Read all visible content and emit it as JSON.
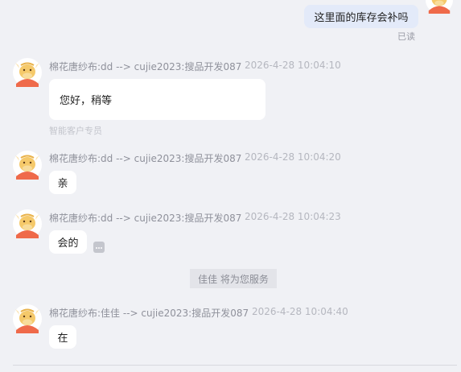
{
  "own_message": {
    "text": "这里面的库存会补吗",
    "status": "已读"
  },
  "messages": [
    {
      "sender": "棉花唐纱布:dd --> cujie2023:搜品开发087",
      "time": "2026-4-28 10:04:10",
      "text": "您好，稍等",
      "tag": "智能客户专员"
    },
    {
      "sender": "棉花唐纱布:dd --> cujie2023:搜品开发087",
      "time": "2026-4-28 10:04:20",
      "text": "亲"
    },
    {
      "sender": "棉花唐纱布:dd --> cujie2023:搜品开发087",
      "time": "2026-4-28 10:04:23",
      "text": "会的"
    },
    {
      "sender": "棉花唐纱布:佳佳 --> cujie2023:搜品开发087",
      "time": "2026-4-28 10:04:40",
      "text": "在"
    }
  ],
  "system_notice": "佳佳 将为您服务",
  "colors": {
    "background": "#f0f1f5",
    "own_bubble": "#e3eaf9",
    "bubble": "#ffffff",
    "avatar_face": "#f5c96a",
    "avatar_body": "#ef6a4a"
  },
  "icons": {
    "avatar": "bull-mascot-avatar",
    "more": "more-options-icon"
  }
}
